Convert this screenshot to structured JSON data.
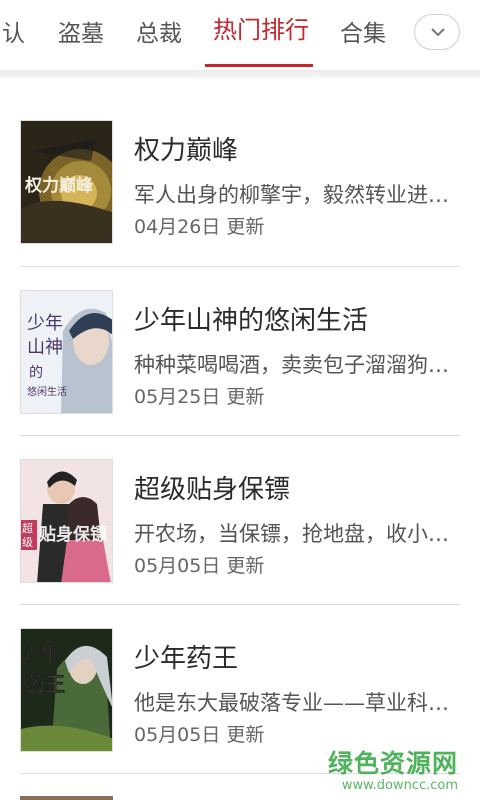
{
  "tabs": [
    {
      "label": "认",
      "active": false
    },
    {
      "label": "盗墓",
      "active": false
    },
    {
      "label": "总裁",
      "active": false
    },
    {
      "label": "热门排行",
      "active": true
    },
    {
      "label": "合集",
      "active": false
    }
  ],
  "more_button_icon": "chevron-down-icon",
  "accent_color": "#c6262c",
  "books": [
    {
      "title": "权力巅峰",
      "desc": "军人出身的柳擎宇，毅然转业进入…",
      "date": "04月26日 更新",
      "cover_text": "权力巅峰"
    },
    {
      "title": "少年山神的悠闲生活",
      "desc": "种种菜喝喝酒，卖卖包子溜溜狗。…",
      "date": "05月25日 更新",
      "cover_text": "少年山神的悠闲生活"
    },
    {
      "title": "超级贴身保镖",
      "desc": "开农场，当保镖，抢地盘，收小弟…",
      "date": "05月05日 更新",
      "cover_text": "超级贴身保镖"
    },
    {
      "title": "少年药王",
      "desc": "他是东大最破落专业——草业科学的…",
      "date": "05月05日 更新",
      "cover_text": "少年药王"
    }
  ],
  "watermark": {
    "main": "绿色资源网",
    "sub": "www.downcc.com"
  }
}
